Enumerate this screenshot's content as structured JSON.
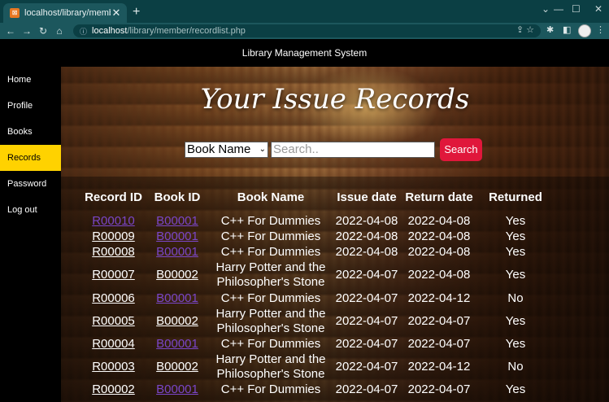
{
  "browser": {
    "tab_title": "localhost/library/member/recordl",
    "url_host": "localhost",
    "url_path": "/library/member/recordlist.php"
  },
  "site": {
    "header_title": "Library Management System"
  },
  "sidebar": {
    "items": [
      {
        "label": "Home",
        "active": false
      },
      {
        "label": "Profile",
        "active": false
      },
      {
        "label": "Books",
        "active": false
      },
      {
        "label": "Records",
        "active": true
      },
      {
        "label": "Password",
        "active": false
      },
      {
        "label": "Log out",
        "active": false
      }
    ]
  },
  "main": {
    "title": "Your Issue Records",
    "search": {
      "select_value": "Book Name",
      "placeholder": "Search..",
      "button_label": "Search"
    },
    "table": {
      "headers": [
        "Record ID",
        "Book ID",
        "Book Name",
        "Issue date",
        "Return date",
        "Returned"
      ],
      "rows": [
        {
          "record_id": "R00010",
          "book_id": "B00001",
          "book_name": "C++ For Dummies",
          "issue_date": "2022-04-08",
          "return_date": "2022-04-08",
          "returned": "Yes",
          "record_visited": true,
          "book_visited": true
        },
        {
          "record_id": "R00009",
          "book_id": "B00001",
          "book_name": "C++ For Dummies",
          "issue_date": "2022-04-08",
          "return_date": "2022-04-08",
          "returned": "Yes",
          "record_visited": false,
          "book_visited": true
        },
        {
          "record_id": "R00008",
          "book_id": "B00001",
          "book_name": "C++ For Dummies",
          "issue_date": "2022-04-08",
          "return_date": "2022-04-08",
          "returned": "Yes",
          "record_visited": false,
          "book_visited": true
        },
        {
          "record_id": "R00007",
          "book_id": "B00002",
          "book_name": "Harry Potter and the Philosopher's Stone",
          "issue_date": "2022-04-07",
          "return_date": "2022-04-08",
          "returned": "Yes",
          "record_visited": false,
          "book_visited": false
        },
        {
          "record_id": "R00006",
          "book_id": "B00001",
          "book_name": "C++ For Dummies",
          "issue_date": "2022-04-07",
          "return_date": "2022-04-12",
          "returned": "No",
          "record_visited": false,
          "book_visited": true
        },
        {
          "record_id": "R00005",
          "book_id": "B00002",
          "book_name": "Harry Potter and the Philosopher's Stone",
          "issue_date": "2022-04-07",
          "return_date": "2022-04-07",
          "returned": "Yes",
          "record_visited": false,
          "book_visited": false
        },
        {
          "record_id": "R00004",
          "book_id": "B00001",
          "book_name": "C++ For Dummies",
          "issue_date": "2022-04-07",
          "return_date": "2022-04-07",
          "returned": "Yes",
          "record_visited": false,
          "book_visited": true
        },
        {
          "record_id": "R00003",
          "book_id": "B00002",
          "book_name": "Harry Potter and the Philosopher's Stone",
          "issue_date": "2022-04-07",
          "return_date": "2022-04-12",
          "returned": "No",
          "record_visited": false,
          "book_visited": false
        },
        {
          "record_id": "R00002",
          "book_id": "B00001",
          "book_name": "C++ For Dummies",
          "issue_date": "2022-04-07",
          "return_date": "2022-04-07",
          "returned": "Yes",
          "record_visited": false,
          "book_visited": true
        }
      ]
    }
  },
  "colors": {
    "active_nav": "#ffd200",
    "search_button": "#e0173b",
    "visited_link": "#7a46c8",
    "browser_frame": "#1c575d"
  }
}
